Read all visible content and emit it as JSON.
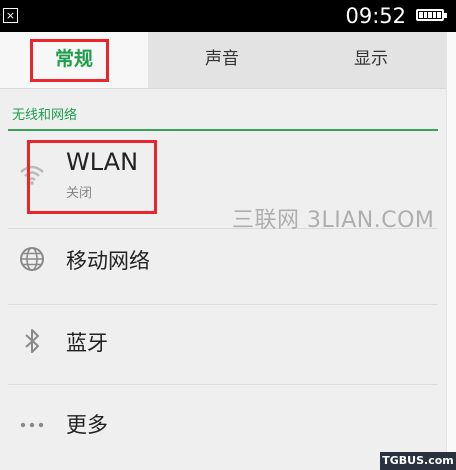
{
  "status_bar": {
    "time": "09:52",
    "notification_glyph": "×"
  },
  "tabs": [
    {
      "label": "常规",
      "active": true
    },
    {
      "label": "声音",
      "active": false
    },
    {
      "label": "显示",
      "active": false
    }
  ],
  "section": {
    "header": "无线和网络"
  },
  "items": [
    {
      "icon": "wifi-icon",
      "title": "WLAN",
      "subtitle": "关闭"
    },
    {
      "icon": "globe-icon",
      "title": "移动网络"
    },
    {
      "icon": "bluetooth-icon",
      "title": "蓝牙"
    },
    {
      "icon": "more-dots-icon",
      "title": "更多"
    }
  ],
  "watermark": "三联网 3LIAN.COM",
  "corner_logo": "TGBUS.com",
  "colors": {
    "accent_green": "#1f9e4c",
    "highlight_red": "#e8262c"
  }
}
